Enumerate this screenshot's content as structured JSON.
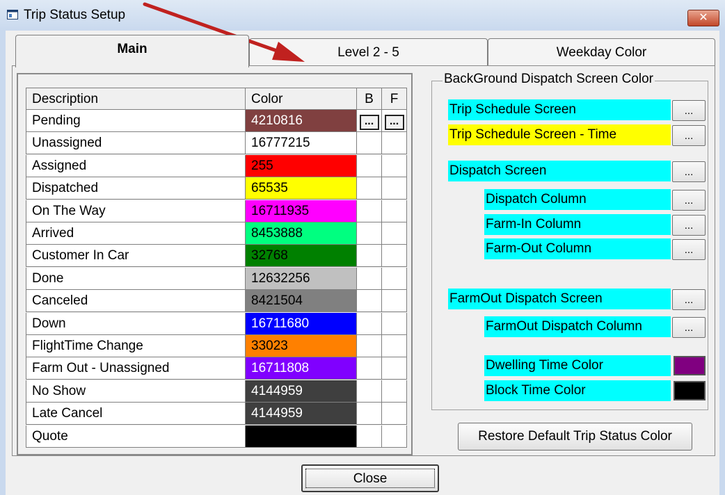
{
  "window": {
    "title": "Trip Status Setup",
    "close_glyph": "✕"
  },
  "tabs": [
    {
      "label": "Main",
      "active": true
    },
    {
      "label": "Level 2 - 5",
      "active": false
    },
    {
      "label": "Weekday Color",
      "active": false
    }
  ],
  "status_table": {
    "headers": {
      "description": "Description",
      "color": "Color",
      "b": "B",
      "f": "F"
    },
    "button_glyph": "...",
    "rows": [
      {
        "description": "Pending",
        "color": "4210816",
        "bg": "#804040",
        "fg": "#ffffff"
      },
      {
        "description": "Unassigned",
        "color": "16777215",
        "bg": "#ffffff",
        "fg": "#000000"
      },
      {
        "description": "Assigned",
        "color": "255",
        "bg": "#ff0000",
        "fg": "#000000"
      },
      {
        "description": "Dispatched",
        "color": "65535",
        "bg": "#ffff00",
        "fg": "#000000"
      },
      {
        "description": "On The Way",
        "color": "16711935",
        "bg": "#ff00ff",
        "fg": "#000000"
      },
      {
        "description": "Arrived",
        "color": "8453888",
        "bg": "#00ff80",
        "fg": "#000000"
      },
      {
        "description": "Customer In Car",
        "color": "32768",
        "bg": "#008000",
        "fg": "#000000"
      },
      {
        "description": "Done",
        "color": "12632256",
        "bg": "#c0c0c0",
        "fg": "#000000"
      },
      {
        "description": "Canceled",
        "color": "8421504",
        "bg": "#808080",
        "fg": "#000000"
      },
      {
        "description": "Down",
        "color": "16711680",
        "bg": "#0000ff",
        "fg": "#ffffff"
      },
      {
        "description": "FlightTime Change",
        "color": "33023",
        "bg": "#ff8000",
        "fg": "#000000"
      },
      {
        "description": "Farm Out - Unassigned",
        "color": "16711808",
        "bg": "#8000ff",
        "fg": "#ffffff"
      },
      {
        "description": "No Show",
        "color": "4144959",
        "bg": "#3f3f3f",
        "fg": "#ffffff"
      },
      {
        "description": "Late Cancel",
        "color": "4144959",
        "bg": "#3f3f3f",
        "fg": "#ffffff"
      },
      {
        "description": "Quote",
        "color": "",
        "bg": "#000000",
        "fg": "#ffffff"
      }
    ]
  },
  "background_group": {
    "title": "BackGround Dispatch Screen Color",
    "button_glyph": "...",
    "trip_schedule_screen": "Trip Schedule Screen",
    "trip_schedule_screen_time": "Trip Schedule Screen - Time",
    "dispatch_screen": "Dispatch Screen",
    "dispatch_column": "Dispatch Column",
    "farm_in_column": "Farm-In Column",
    "farm_out_column": "Farm-Out Column",
    "farmout_dispatch_screen": "FarmOut Dispatch Screen",
    "farmout_dispatch_column": "FarmOut Dispatch Column",
    "dwelling_time_color": "Dwelling Time Color",
    "block_time_color": "Block Time Color",
    "dwelling_swatch": "#800080",
    "block_swatch": "#000000"
  },
  "buttons": {
    "restore": "Restore Default Trip Status Color",
    "close": "Close"
  },
  "colors": {
    "cyan": "#00ffff",
    "yellow": "#ffff00",
    "arrow": "#c0211f"
  }
}
